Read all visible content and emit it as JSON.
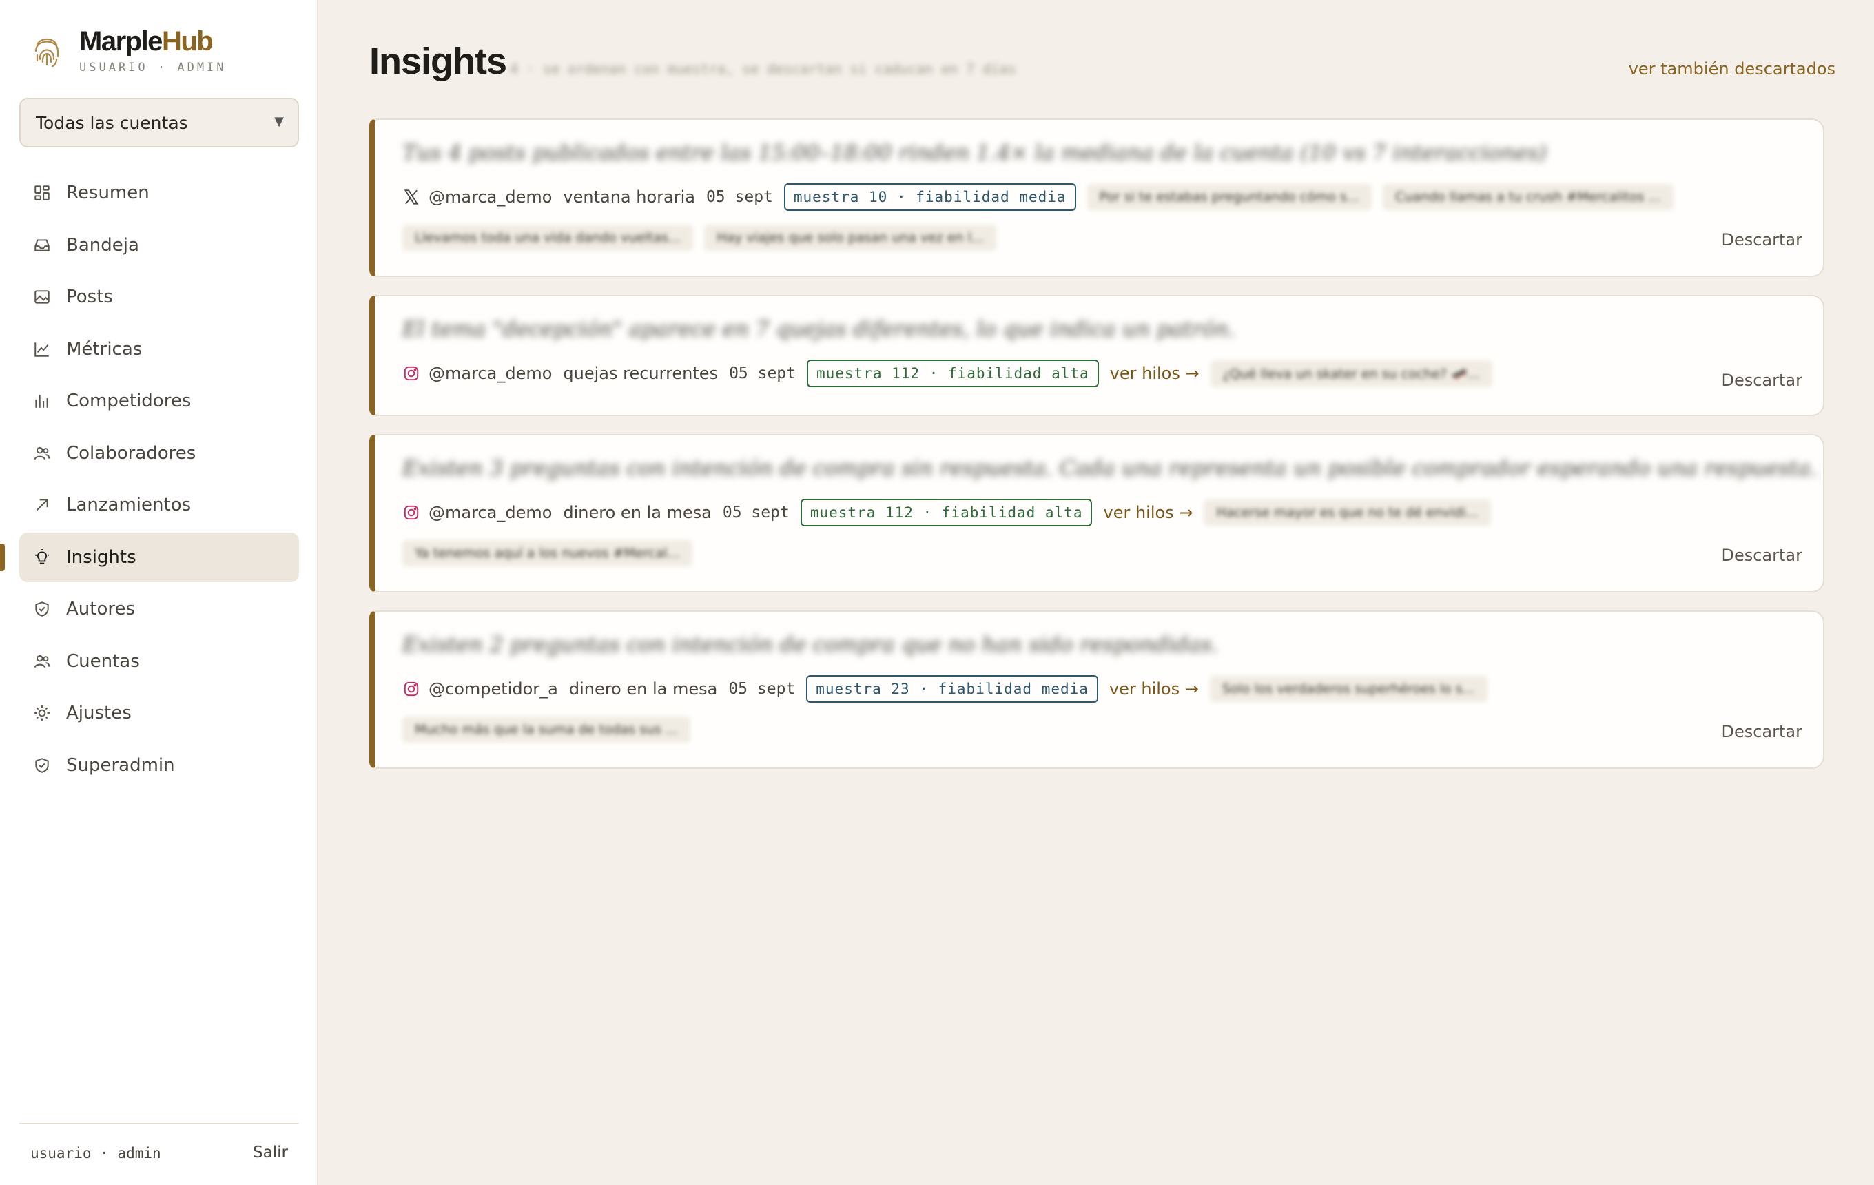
{
  "brand": {
    "name_a": "Marple",
    "name_b": "Hub",
    "subtitle": "USUARIO · ADMIN"
  },
  "account_select": {
    "value": "Todas las cuentas"
  },
  "nav": {
    "items": [
      {
        "label": "Resumen",
        "icon": "dashboard-icon"
      },
      {
        "label": "Bandeja",
        "icon": "inbox-icon"
      },
      {
        "label": "Posts",
        "icon": "image-icon"
      },
      {
        "label": "Métricas",
        "icon": "line-chart-icon"
      },
      {
        "label": "Competidores",
        "icon": "bar-chart-icon"
      },
      {
        "label": "Colaboradores",
        "icon": "users-icon"
      },
      {
        "label": "Lanzamientos",
        "icon": "arrow-up-right-icon"
      },
      {
        "label": "Insights",
        "icon": "lightbulb-icon"
      },
      {
        "label": "Autores",
        "icon": "shield-check-icon"
      },
      {
        "label": "Cuentas",
        "icon": "users-icon"
      },
      {
        "label": "Ajustes",
        "icon": "sun-gear-icon"
      },
      {
        "label": "Superadmin",
        "icon": "shield-check-icon"
      }
    ],
    "active": "Insights"
  },
  "footer": {
    "user": "usuario · admin",
    "logout": "Salir"
  },
  "header": {
    "title": "Insights",
    "subtitle": "4 · se ordenan con muestra, se descartan si caducan en 7 días",
    "see_discarded": "ver también descartados"
  },
  "insights": [
    {
      "title": "Tus 4 posts publicados entre las 15:00–18:00 rinden 1.4× la mediana de la cuenta (10 vs 7 interacciones)",
      "network": "x-icon",
      "handle": "@marca_demo",
      "kind": "ventana horaria",
      "date": "05 sept",
      "badge": "muestra 10 · fiabilidad media",
      "reliability": "media",
      "threads_link": "",
      "chips": [
        "Por si te estabas preguntando cómo s...",
        "Cuando llamas a tu crush #Mercalitos ...",
        "Llevamos toda una vida dando vueltas...",
        "Hay viajes que solo pasan una vez en l..."
      ],
      "dismiss": "Descartar"
    },
    {
      "title": "El tema \"decepción\" aparece en 7 quejas diferentes, lo que indica un patrón.",
      "network": "instagram-icon",
      "handle": "@marca_demo",
      "kind": "quejas recurrentes",
      "date": "05 sept",
      "badge": "muestra 112 · fiabilidad alta",
      "reliability": "alta",
      "threads_link": "ver hilos →",
      "chips": [
        "¿Qué lleva un skater en su coche? 🛹..."
      ],
      "dismiss": "Descartar"
    },
    {
      "title": "Existen 3 preguntas con intención de compra sin respuesta. Cada una representa un posible comprador esperando una respuesta.",
      "network": "instagram-icon",
      "handle": "@marca_demo",
      "kind": "dinero en la mesa",
      "date": "05 sept",
      "badge": "muestra 112 · fiabilidad alta",
      "reliability": "alta",
      "threads_link": "ver hilos →",
      "chips": [
        "Hacerse mayor es que no te dé envidi...",
        "Ya tenemos aquí a los nuevos #Mercal..."
      ],
      "dismiss": "Descartar"
    },
    {
      "title": "Existen 2 preguntas con intención de compra que no han sido respondidas.",
      "network": "instagram-icon",
      "handle": "@competidor_a",
      "kind": "dinero en la mesa",
      "date": "05 sept",
      "badge": "muestra 23 · fiabilidad media",
      "reliability": "media",
      "threads_link": "ver hilos →",
      "chips": [
        "Solo los verdaderos superhéroes lo s...",
        "Mucho más que la suma de todas sus ..."
      ],
      "dismiss": "Descartar"
    }
  ],
  "colors": {
    "accent": "#8a6420",
    "media": "#2e5870",
    "alta": "#2f6a3a",
    "instagram": "#c0306a"
  }
}
